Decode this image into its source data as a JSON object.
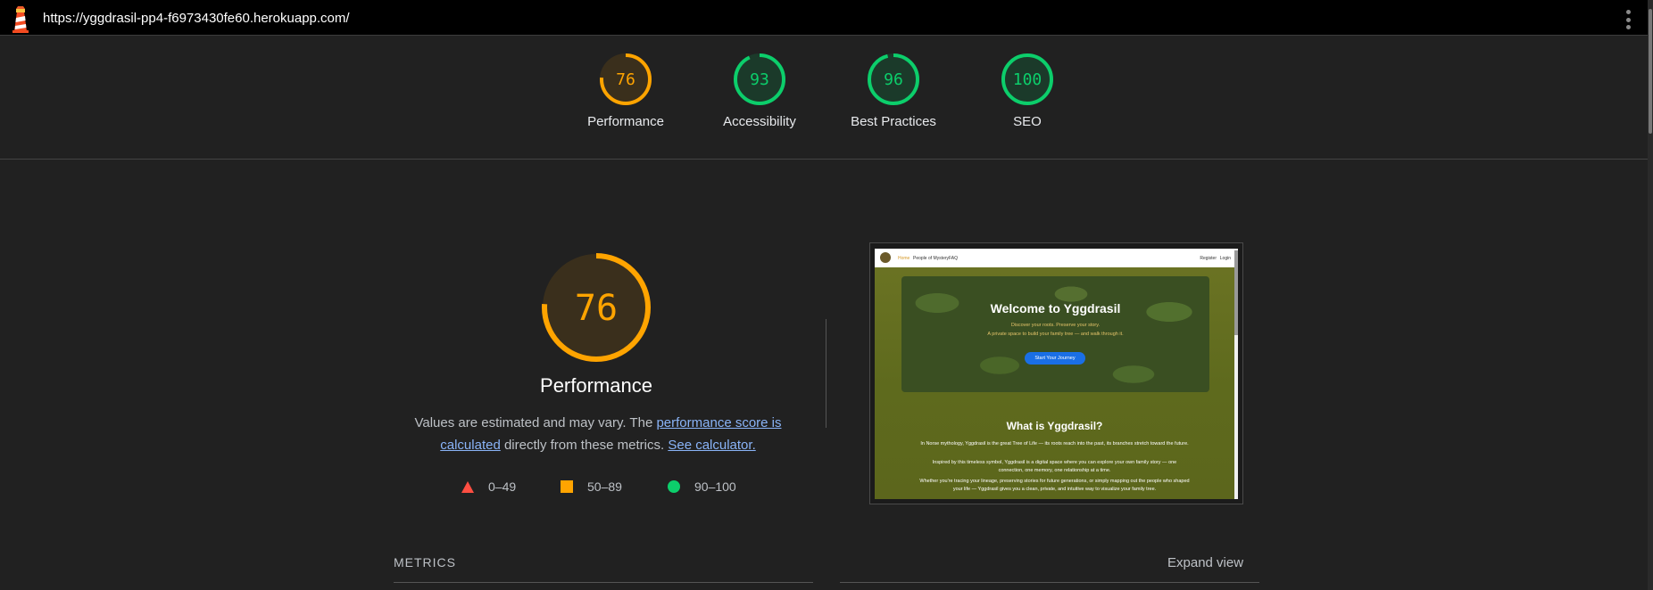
{
  "url": "https://yggdrasil-pp4-f6973430fe60.herokuapp.com/",
  "colors": {
    "pass": "#0cce6b",
    "average": "#ffa400",
    "fail": "#ff4e42",
    "link": "#8ab4f8"
  },
  "header_scores": [
    {
      "label": "Performance",
      "score": "76",
      "value": 0.76,
      "rating": "average"
    },
    {
      "label": "Accessibility",
      "score": "93",
      "value": 0.93,
      "rating": "pass"
    },
    {
      "label": "Best Practices",
      "score": "96",
      "value": 0.96,
      "rating": "pass"
    },
    {
      "label": "SEO",
      "score": "100",
      "value": 1.0,
      "rating": "pass"
    }
  ],
  "main_gauge": {
    "score": "76",
    "value": 0.76,
    "title": "Performance"
  },
  "description": {
    "text1": "Values are estimated and may vary. The ",
    "link1": "performance score is calculated",
    "text2": " directly from these metrics. ",
    "link2": "See calculator."
  },
  "legend": [
    {
      "range": "0–49",
      "shape": "triangle"
    },
    {
      "range": "50–89",
      "shape": "square"
    },
    {
      "range": "90–100",
      "shape": "circle"
    }
  ],
  "thumbnail": {
    "nav": {
      "home": "Home",
      "people": "People of Mystery",
      "faq": "FAQ",
      "register": "Register",
      "login": "Login"
    },
    "hero_title": "Welcome to Yggdrasil",
    "hero_sub1": "Discover your roots. Preserve your story.",
    "hero_sub2": "A private space to build your family tree — and walk through it.",
    "hero_button": "Start Your Journey",
    "section_title": "What is Yggdrasil?",
    "p1": "In Norse mythology, Yggdrasil is the great Tree of Life — its roots reach into the past, its branches stretch toward the future.",
    "p2": "Inspired by this timeless symbol, Yggdrasil is a digital space where you can explore your own family story — one connection, one memory, one relationship at a time.",
    "p3": "Whether you're tracing your lineage, preserving stories for future generations, or simply mapping out the people who shaped your life — Yggdrasil gives you a clean, private, and intuitive way to visualize your family tree."
  },
  "metrics_label": "METRICS",
  "expand_label": "Expand view"
}
